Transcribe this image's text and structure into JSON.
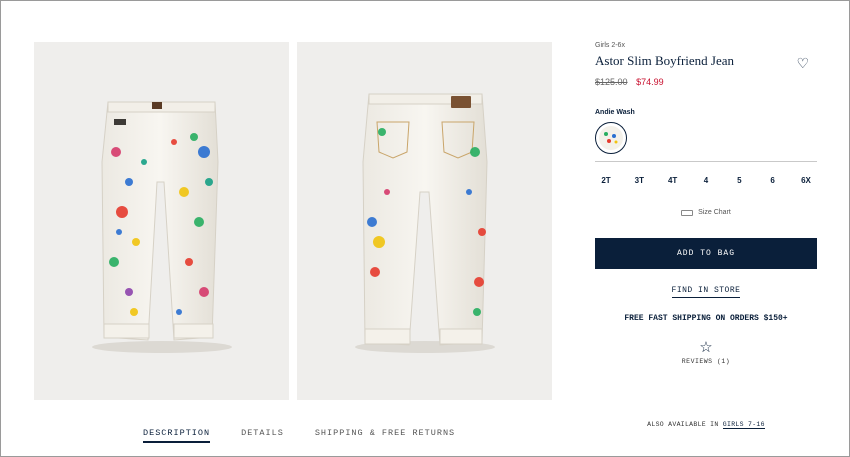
{
  "product": {
    "category": "Girls 2-6x",
    "title": "Astor Slim Boyfriend Jean",
    "price_original": "$125.00",
    "price_sale": "$74.99",
    "wash_label": "Andie Wash",
    "sizes": [
      "2T",
      "3T",
      "4T",
      "4",
      "5",
      "6",
      "6X"
    ],
    "size_chart_label": "Size Chart",
    "add_to_bag_label": "ADD TO BAG",
    "find_in_store_label": "FIND IN STORE",
    "shipping_text": "FREE FAST SHIPPING ON ORDERS $150+",
    "reviews_label": "REVIEWS (1)",
    "also_available_prefix": "ALSO AVAILABLE IN",
    "also_available_link": "GIRLS 7-16"
  },
  "tabs": [
    {
      "label": "DESCRIPTION",
      "active": true
    },
    {
      "label": "DETAILS",
      "active": false
    },
    {
      "label": "SHIPPING & FREE RETURNS",
      "active": false
    }
  ],
  "icons": {
    "wishlist": "heart-outline-icon",
    "reviews": "star-outline-icon",
    "size_chart": "ruler-icon"
  },
  "colors": {
    "navy": "#0a1f3a",
    "sale_red": "#c8102e",
    "image_bg": "#efeeec"
  }
}
